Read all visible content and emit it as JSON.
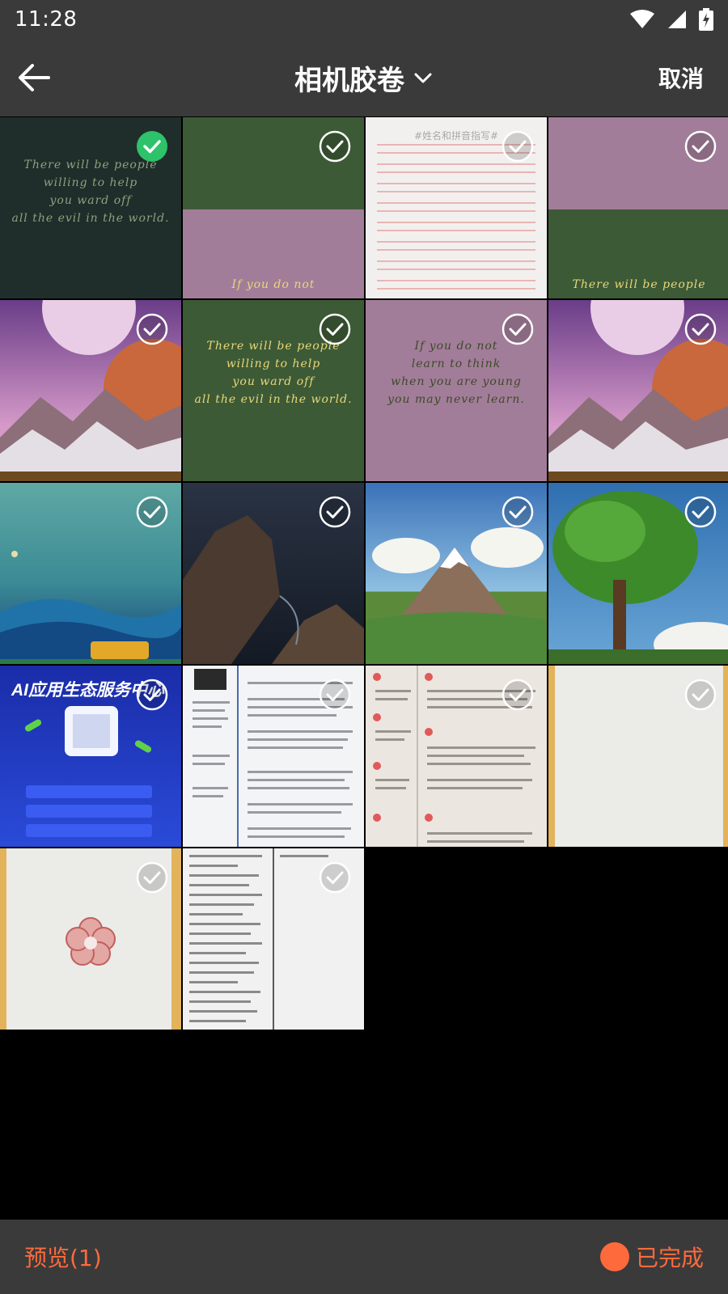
{
  "status": {
    "time": "11:28"
  },
  "header": {
    "title": "相机胶卷",
    "cancel_label": "取消"
  },
  "captions": {
    "people": [
      "There will be people",
      "willing to help",
      "you ward off",
      "all the evil in the world."
    ],
    "learn": [
      "If you do not",
      "learn to think",
      "when you are young",
      "you may never learn."
    ],
    "if_short": "If you do not",
    "people_short": "There will be people"
  },
  "paper": {
    "title": "#姓名和拼音指写#"
  },
  "banner": {
    "title": "AI应用生态服务中心"
  },
  "bottom": {
    "preview_label": "预览(1)",
    "done_label": "已完成"
  },
  "colors": {
    "accent": "#ff6a3c",
    "selected": "#2ec26a",
    "bar": "#3a3a3a"
  }
}
